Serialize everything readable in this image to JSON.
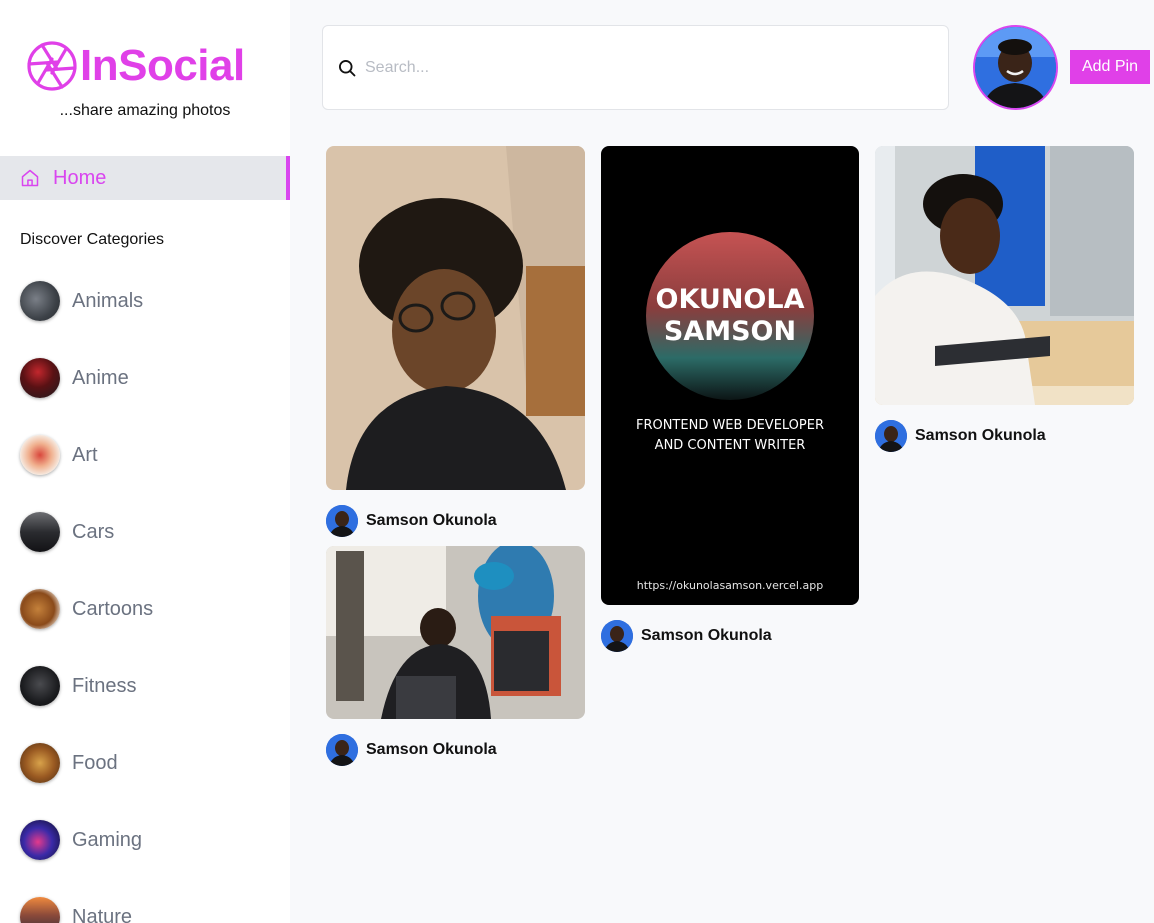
{
  "app": {
    "name": "InSocial",
    "tagline": "...share amazing photos"
  },
  "sidebar": {
    "home_label": "Home",
    "categories_title": "Discover Categories",
    "categories": [
      {
        "label": "Animals"
      },
      {
        "label": "Anime"
      },
      {
        "label": "Art"
      },
      {
        "label": "Cars"
      },
      {
        "label": "Cartoons"
      },
      {
        "label": "Fitness"
      },
      {
        "label": "Food"
      },
      {
        "label": "Gaming"
      },
      {
        "label": "Nature"
      }
    ]
  },
  "search": {
    "placeholder": "Search...",
    "value": ""
  },
  "header": {
    "add_pin_label": "Add Pin"
  },
  "pins": [
    {
      "author": "Samson Okunola"
    },
    {
      "author": "Samson Okunola"
    },
    {
      "author": "Samson Okunola",
      "poster": {
        "name_line1": "OKUNOLA",
        "name_line2": "SAMSON",
        "role_line1": "FRONTEND WEB DEVELOPER",
        "role_line2": "AND CONTENT WRITER",
        "url": "https://okunolasamson.vercel.app"
      }
    },
    {
      "author": "Samson Okunola"
    }
  ],
  "colors": {
    "accent": "#d946ef",
    "brand": "#e040e8",
    "active_bg": "#e5e7eb",
    "page_bg": "#f8f9fb"
  },
  "icons": {
    "logo": "camera-aperture-icon",
    "home": "home-icon",
    "search": "search-icon"
  }
}
